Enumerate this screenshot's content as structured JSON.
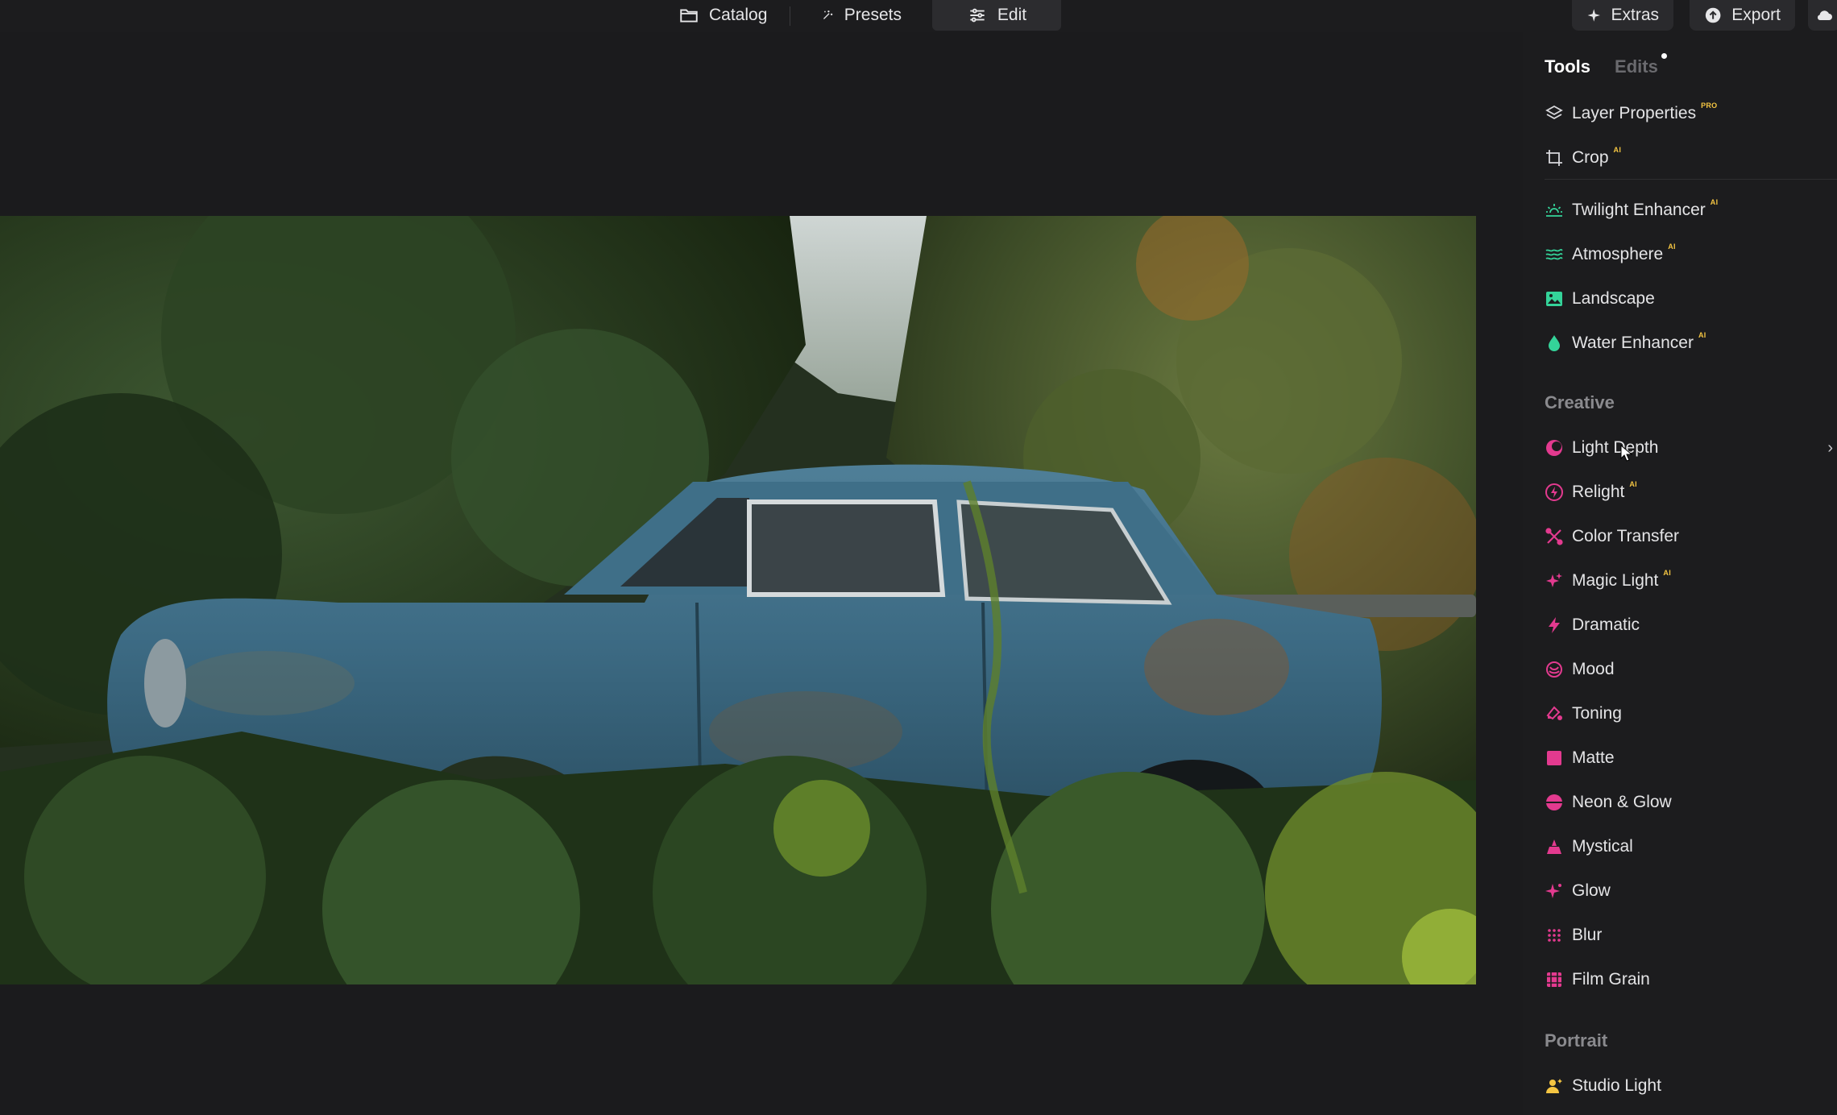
{
  "topbar": {
    "tabs": [
      {
        "label": "Catalog",
        "icon": "folder-icon"
      },
      {
        "label": "Presets",
        "icon": "sparkle-wand-icon"
      },
      {
        "label": "Edit",
        "icon": "sliders-icon",
        "active": true
      }
    ],
    "extras_label": "Extras",
    "export_label": "Export"
  },
  "panel": {
    "tabs": {
      "tools": "Tools",
      "edits": "Edits"
    },
    "essentials": [
      {
        "label": "Layer Properties",
        "badge": "PRO",
        "icon": "layers-icon",
        "color": "#d8d8dc"
      },
      {
        "label": "Crop",
        "badge": "AI",
        "icon": "crop-icon",
        "color": "#d8d8dc"
      }
    ],
    "landscape_tools": [
      {
        "label": "Twilight Enhancer",
        "badge": "AI",
        "icon": "sunrise-icon",
        "color": "#34d399"
      },
      {
        "label": "Atmosphere",
        "badge": "AI",
        "icon": "waves-icon",
        "color": "#34d399"
      },
      {
        "label": "Landscape",
        "badge": "",
        "icon": "image-icon",
        "color": "#34d399"
      },
      {
        "label": "Water Enhancer",
        "badge": "AI",
        "icon": "droplet-icon",
        "color": "#34d399"
      }
    ],
    "creative_title": "Creative",
    "creative": [
      {
        "label": "Light Depth",
        "badge": "",
        "icon": "light-depth-icon",
        "color": "#e33a8f"
      },
      {
        "label": "Relight",
        "badge": "AI",
        "icon": "relight-icon",
        "color": "#e33a8f"
      },
      {
        "label": "Color Transfer",
        "badge": "",
        "icon": "color-transfer-icon",
        "color": "#e33a8f"
      },
      {
        "label": "Magic Light",
        "badge": "AI",
        "icon": "magic-light-icon",
        "color": "#e33a8f"
      },
      {
        "label": "Dramatic",
        "badge": "",
        "icon": "lightning-icon",
        "color": "#e33a8f"
      },
      {
        "label": "Mood",
        "badge": "",
        "icon": "mood-icon",
        "color": "#e33a8f"
      },
      {
        "label": "Toning",
        "badge": "",
        "icon": "toning-icon",
        "color": "#e33a8f"
      },
      {
        "label": "Matte",
        "badge": "",
        "icon": "matte-icon",
        "color": "#e33a8f"
      },
      {
        "label": "Neon & Glow",
        "badge": "",
        "icon": "neon-icon",
        "color": "#e33a8f"
      },
      {
        "label": "Mystical",
        "badge": "",
        "icon": "mystical-icon",
        "color": "#e33a8f"
      },
      {
        "label": "Glow",
        "badge": "",
        "icon": "glow-icon",
        "color": "#e33a8f"
      },
      {
        "label": "Blur",
        "badge": "",
        "icon": "blur-icon",
        "color": "#e33a8f"
      },
      {
        "label": "Film Grain",
        "badge": "",
        "icon": "film-grain-icon",
        "color": "#e33a8f"
      }
    ],
    "portrait_title": "Portrait",
    "portrait": [
      {
        "label": "Studio Light",
        "badge": "",
        "icon": "studio-light-icon",
        "color": "#f4c542"
      }
    ]
  }
}
